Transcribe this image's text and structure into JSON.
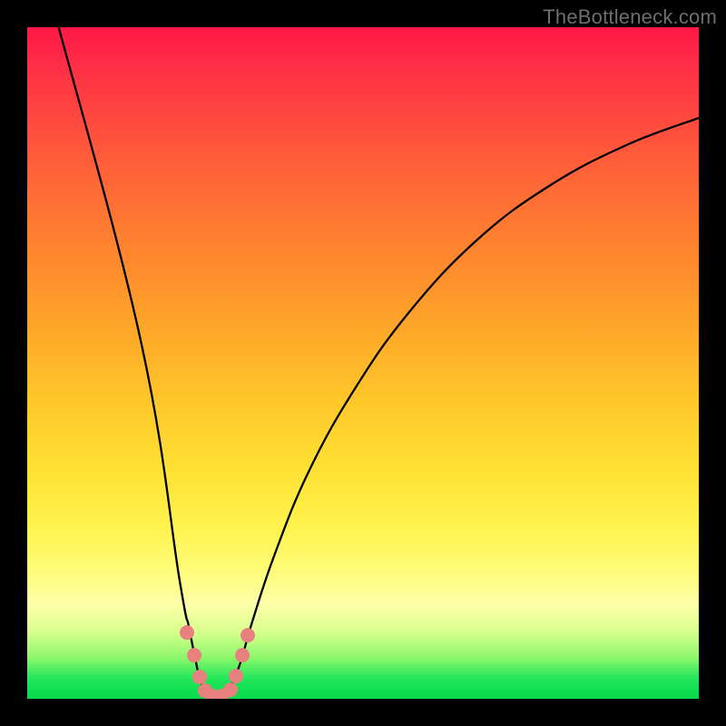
{
  "watermark": "TheBottleneck.com",
  "colors": {
    "frame": "#000000",
    "curve": "#000000",
    "marker": "#e98080",
    "gradient_top": "#ff1746",
    "gradient_bottom": "#06d94e"
  },
  "chart_data": {
    "type": "line",
    "title": "",
    "xlabel": "",
    "ylabel": "",
    "xlim": [
      0,
      100
    ],
    "ylim": [
      0,
      100
    ],
    "grid": false,
    "legend": false,
    "annotations": [
      "TheBottleneck.com"
    ],
    "note": "Single V-shaped bottleneck curve in a 740x740 plot area (SVG coords, y down). Minimum around x≈26% where curve touches the baseline; left branch is steep, right branch rises and decelerates toward top-right.",
    "series": [
      {
        "name": "bottleneck-curve",
        "control_points_svg": [
          [
            32,
            -10
          ],
          [
            125,
            345
          ],
          [
            168,
            610
          ],
          [
            178,
            660
          ],
          [
            186,
            700
          ],
          [
            192,
            724
          ],
          [
            200,
            735
          ],
          [
            212,
            735
          ],
          [
            224,
            726
          ],
          [
            235,
            700
          ],
          [
            248,
            655
          ],
          [
            273,
            580
          ],
          [
            310,
            490
          ],
          [
            360,
            400
          ],
          [
            420,
            315
          ],
          [
            495,
            235
          ],
          [
            575,
            175
          ],
          [
            660,
            130
          ],
          [
            740,
            100
          ]
        ]
      }
    ],
    "markers_svg": [
      [
        176,
        667
      ],
      [
        184,
        692
      ],
      [
        190,
        716
      ],
      [
        196,
        731
      ],
      [
        204,
        737
      ],
      [
        214,
        737
      ],
      [
        224,
        730
      ],
      [
        230,
        715
      ],
      [
        237,
        692
      ],
      [
        243,
        670
      ]
    ]
  }
}
